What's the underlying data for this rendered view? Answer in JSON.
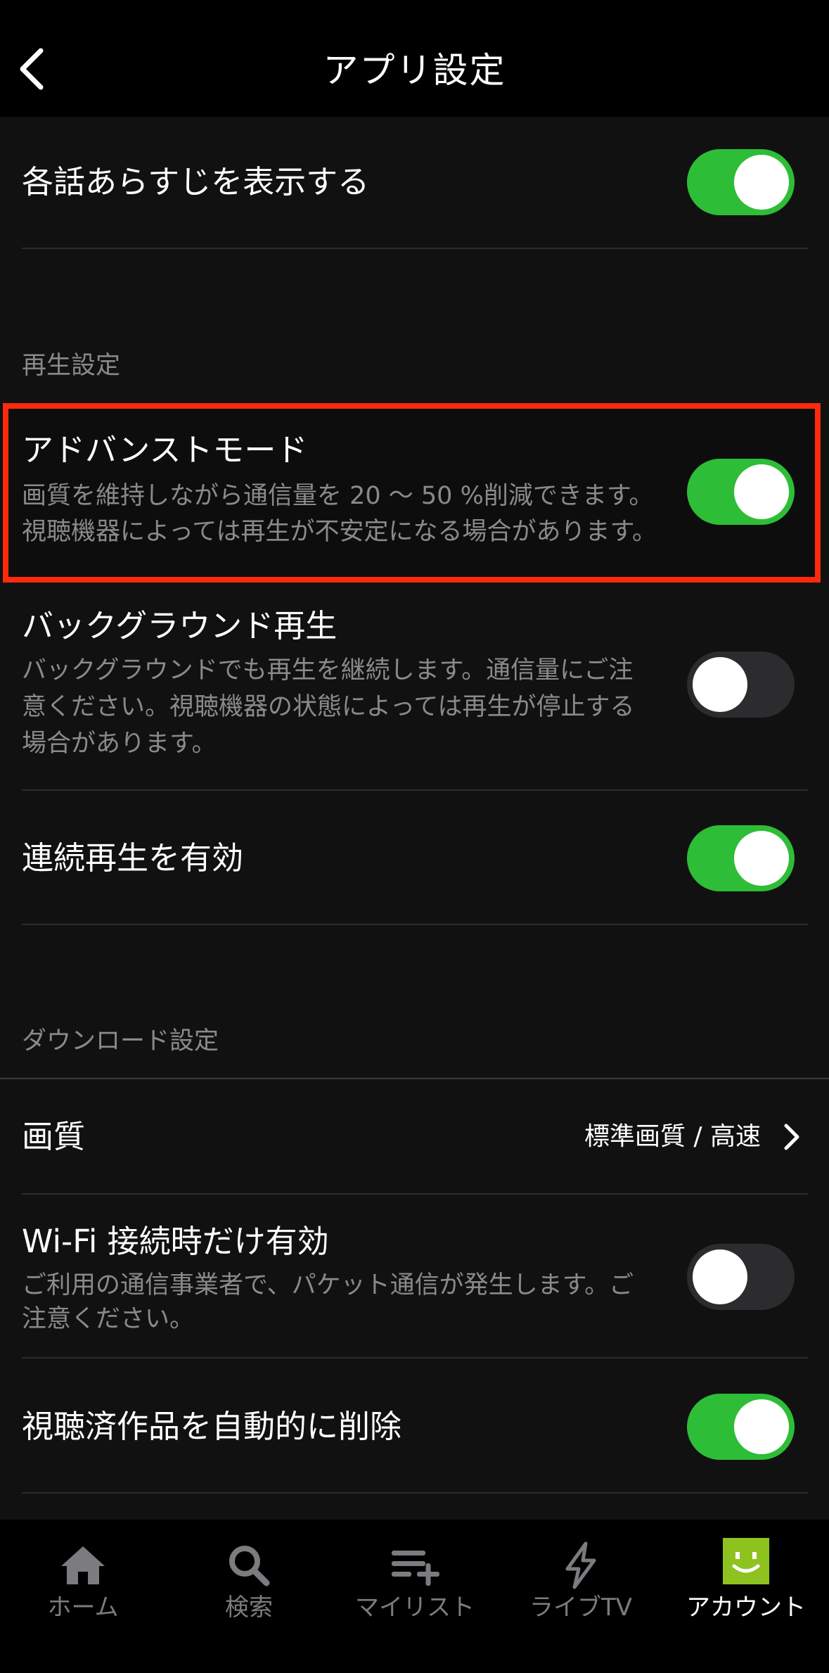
{
  "header": {
    "title": "アプリ設定"
  },
  "settings": {
    "synopsis": {
      "title": "各話あらすじを表示する",
      "enabled": true
    },
    "playback_section": "再生設定",
    "advanced_mode": {
      "title": "アドバンストモード",
      "desc_line1": "画質を維持しながら通信量を 20 〜 50 %削減できます。",
      "desc_line2": "視聴機器によっては再生が不安定になる場合があります。",
      "enabled": true
    },
    "background_play": {
      "title": "バックグラウンド再生",
      "desc_line1": "バックグラウンドでも再生を継続します。通信量にご注",
      "desc_line2": "意ください。視聴機器の状態によっては再生が停止する",
      "desc_line3": "場合があります。",
      "enabled": false
    },
    "continuous_play": {
      "title": "連続再生を有効",
      "enabled": true
    },
    "download_section": "ダウンロード設定",
    "quality": {
      "title": "画質",
      "value": "標準画質 / 高速"
    },
    "wifi_only": {
      "title": "Wi-Fi 接続時だけ有効",
      "desc_line1": "ご利用の通信事業者で、パケット通信が発生します。ご",
      "desc_line2": "注意ください。",
      "enabled": false
    },
    "auto_delete": {
      "title": "視聴済作品を自動的に削除",
      "enabled": true
    }
  },
  "tabbar": {
    "items": [
      {
        "label": "ホーム",
        "icon": "home-icon"
      },
      {
        "label": "検索",
        "icon": "search-icon"
      },
      {
        "label": "マイリスト",
        "icon": "mylist-add-icon"
      },
      {
        "label": "ライブTV",
        "icon": "lightning-icon"
      },
      {
        "label": "アカウント",
        "icon": "account-avatar-icon"
      }
    ],
    "active_index": 4
  },
  "colors": {
    "toggle_on": "#2ebd37",
    "highlight_border": "#ff2a0c",
    "avatar": "#8dc21f"
  }
}
